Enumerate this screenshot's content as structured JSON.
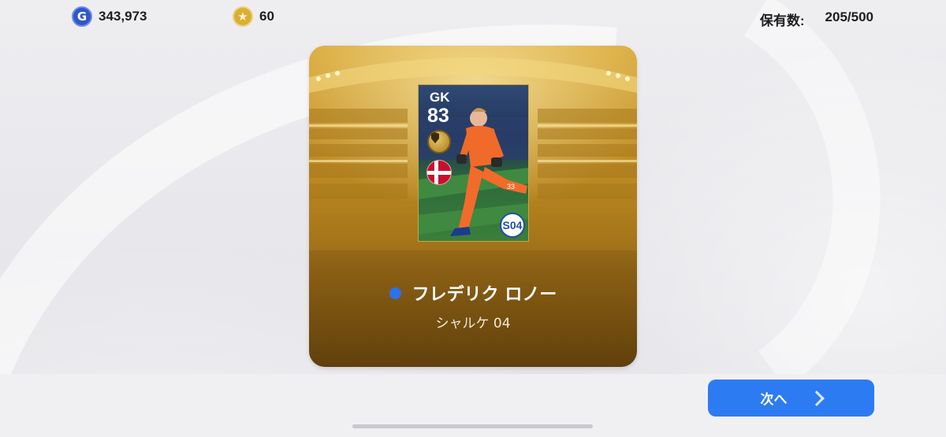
{
  "header": {
    "gp": {
      "icon": "gp-coin-icon",
      "symbol": "G",
      "value": "343,973"
    },
    "coins": {
      "icon": "star-coin-icon",
      "symbol": "★",
      "value": "60"
    },
    "owned": {
      "label": "保有数:",
      "value": "205/500"
    }
  },
  "player": {
    "position": "GK",
    "rating": "83",
    "name": "フレデリク ロノー",
    "team": "シャルケ 04",
    "club_badge_text": "S04",
    "nationality_icon": "denmark-flag-icon"
  },
  "footer": {
    "next_label": "次へ"
  },
  "colors": {
    "accent": "#2c7bf2",
    "card_gold": "#d9a93a",
    "card_brown": "#60400c",
    "name_dot": "#2a72ee"
  }
}
